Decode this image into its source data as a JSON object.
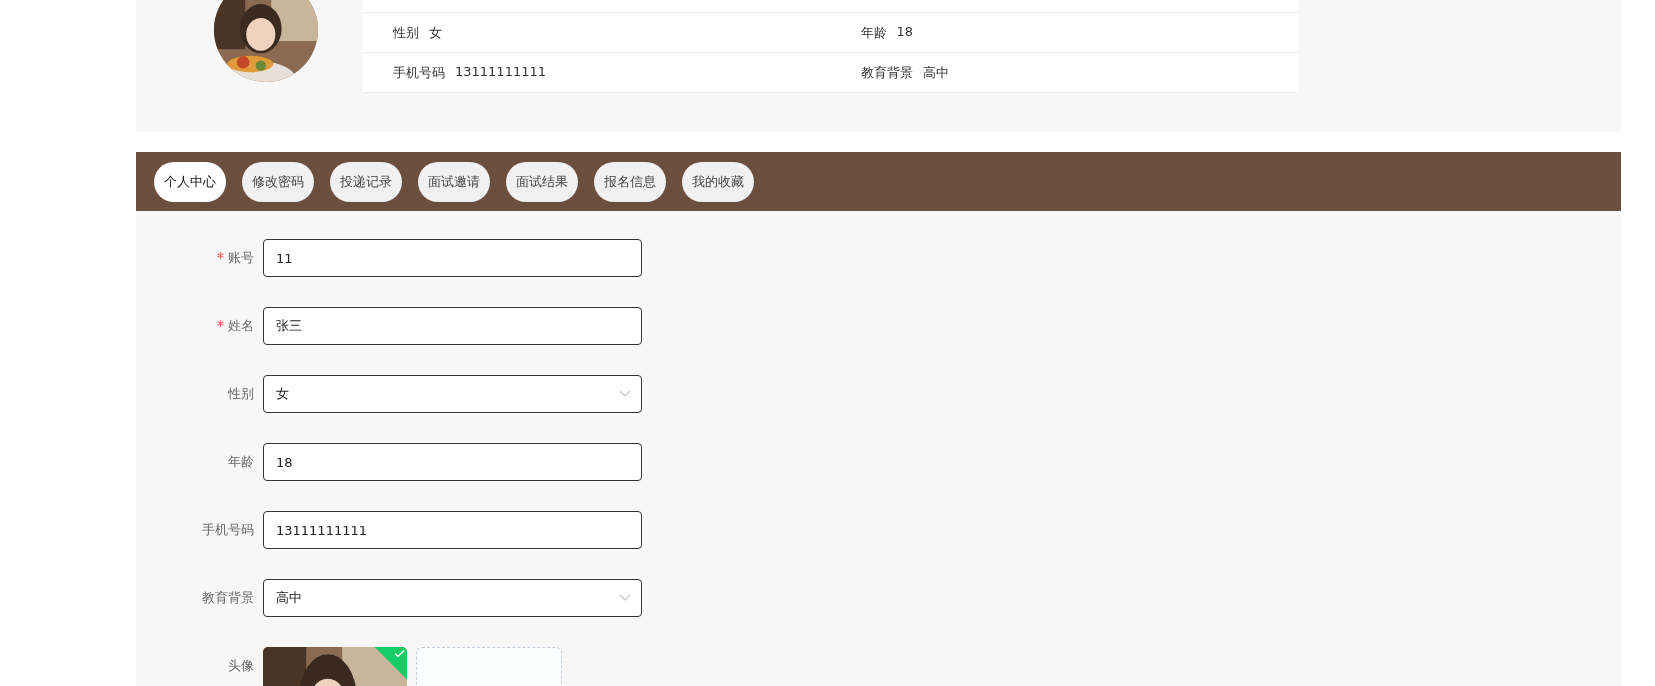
{
  "profile": {
    "info_rows": [
      [
        {
          "label": "性别",
          "value": "女"
        },
        {
          "label": "年龄",
          "value": "18"
        }
      ],
      [
        {
          "label": "手机号码",
          "value": "13111111111"
        },
        {
          "label": "教育背景",
          "value": "高中"
        }
      ]
    ]
  },
  "tabs": [
    {
      "label": "个人中心",
      "selected": true
    },
    {
      "label": "修改密码",
      "selected": false
    },
    {
      "label": "投递记录",
      "selected": false
    },
    {
      "label": "面试邀请",
      "selected": false
    },
    {
      "label": "面试结果",
      "selected": false
    },
    {
      "label": "报名信息",
      "selected": false
    },
    {
      "label": "我的收藏",
      "selected": false
    }
  ],
  "form": {
    "fields": [
      {
        "label": "账号",
        "required": true,
        "kind": "text",
        "value": "11"
      },
      {
        "label": "姓名",
        "required": true,
        "kind": "text",
        "value": "张三"
      },
      {
        "label": "性别",
        "required": false,
        "kind": "select",
        "value": "女"
      },
      {
        "label": "年龄",
        "required": false,
        "kind": "text",
        "value": "18"
      },
      {
        "label": "手机号码",
        "required": false,
        "kind": "text",
        "value": "13111111111"
      },
      {
        "label": "教育背景",
        "required": false,
        "kind": "select",
        "value": "高中"
      },
      {
        "label": "头像",
        "required": false,
        "kind": "upload",
        "success": true
      }
    ]
  }
}
